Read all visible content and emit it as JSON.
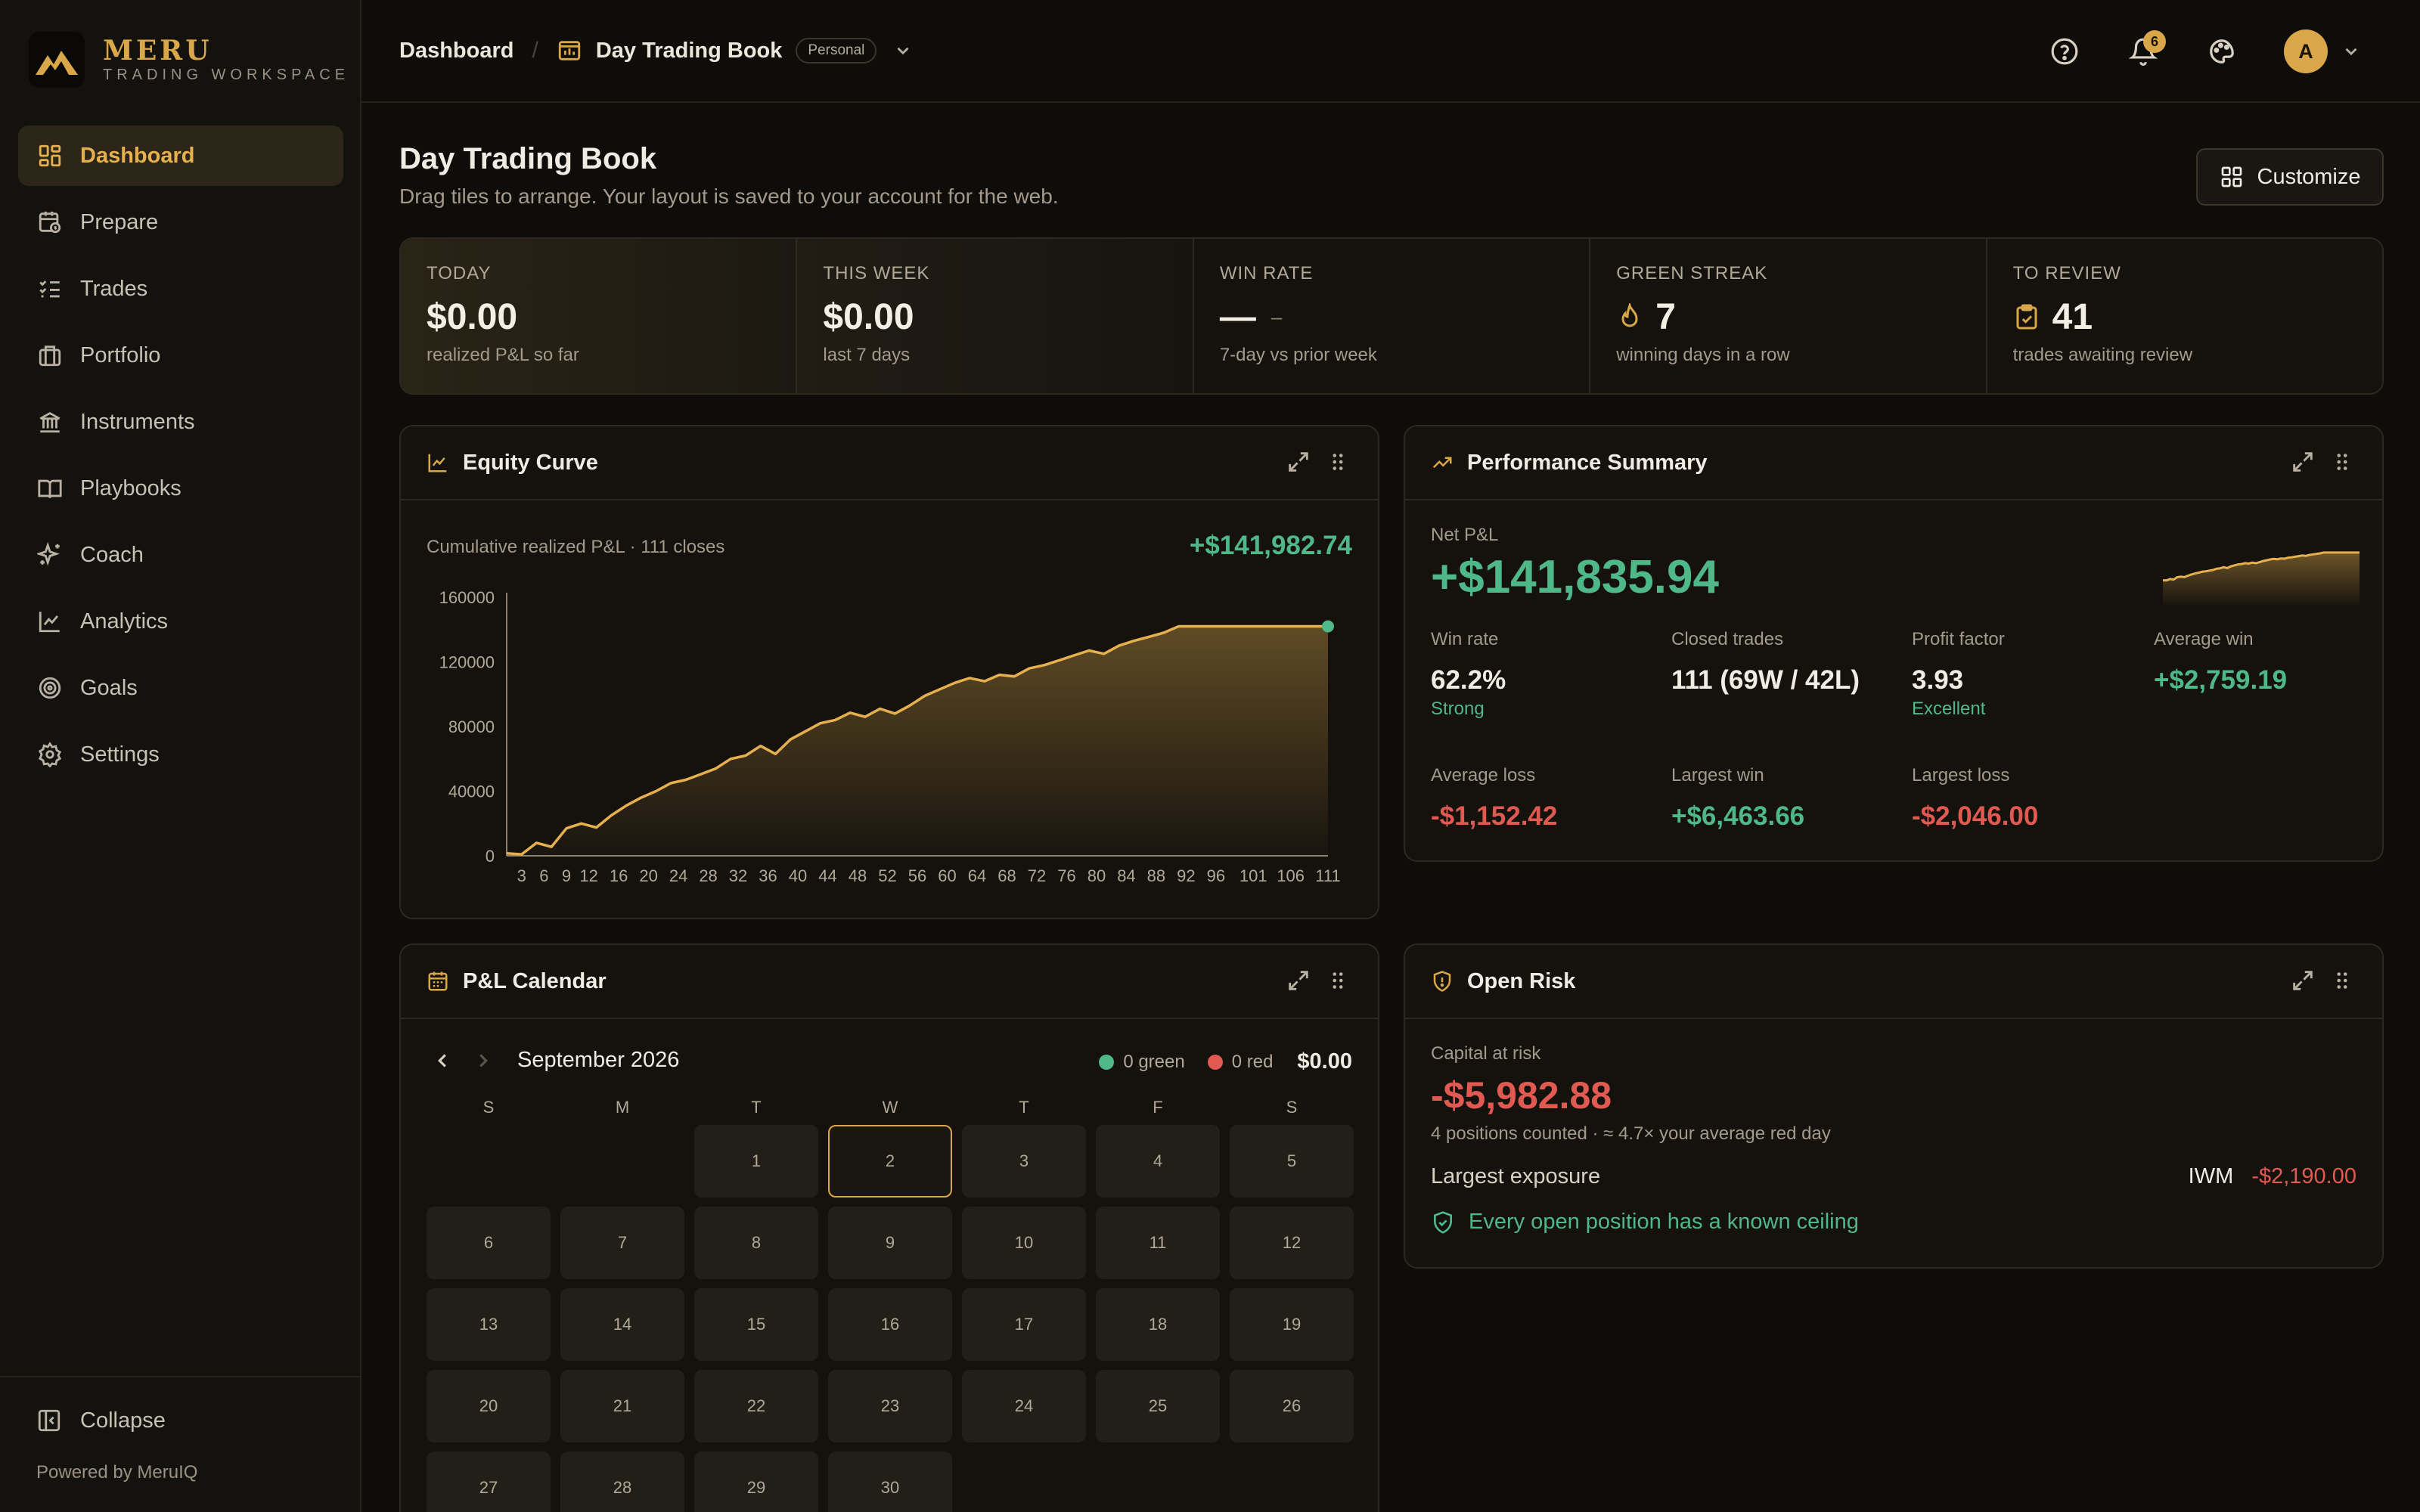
{
  "brand": {
    "name": "MERU",
    "subtitle": "TRADING WORKSPACE"
  },
  "sidebar": {
    "items": [
      {
        "label": "Dashboard",
        "icon": "dashboard-icon",
        "active": true
      },
      {
        "label": "Prepare",
        "icon": "calendar-clock-icon"
      },
      {
        "label": "Trades",
        "icon": "list-checks-icon"
      },
      {
        "label": "Portfolio",
        "icon": "briefcase-icon"
      },
      {
        "label": "Instruments",
        "icon": "bank-icon"
      },
      {
        "label": "Playbooks",
        "icon": "book-icon"
      },
      {
        "label": "Coach",
        "icon": "sparkles-icon"
      },
      {
        "label": "Analytics",
        "icon": "line-chart-icon"
      },
      {
        "label": "Goals",
        "icon": "target-icon"
      },
      {
        "label": "Settings",
        "icon": "gear-icon"
      }
    ],
    "collapse_label": "Collapse",
    "powered_by": "Powered by MeruIQ"
  },
  "topbar": {
    "breadcrumb_root": "Dashboard",
    "separator": "/",
    "book_name": "Day Trading Book",
    "book_badge": "Personal",
    "notification_count": "6",
    "avatar_initial": "A"
  },
  "page": {
    "title": "Day Trading Book",
    "subtitle": "Drag tiles to arrange. Your layout is saved to your account for the web.",
    "customize_label": "Customize"
  },
  "kpis": [
    {
      "label": "TODAY",
      "value": "$0.00",
      "sub": "realized P&L so far"
    },
    {
      "label": "THIS WEEK",
      "value": "$0.00",
      "sub": "last 7 days"
    },
    {
      "label": "WIN RATE",
      "value": "—",
      "small": "–",
      "sub": "7-day vs prior week"
    },
    {
      "label": "GREEN STREAK",
      "value": "7",
      "icon": "flame-icon",
      "sub": "winning days in a row"
    },
    {
      "label": "TO REVIEW",
      "value": "41",
      "icon": "clipboard-check-icon",
      "sub": "trades awaiting review"
    }
  ],
  "equity": {
    "title": "Equity Curve",
    "subtitle": "Cumulative realized P&L · 111 closes",
    "total": "+$141,982.74"
  },
  "chart_data": {
    "type": "area",
    "title": "Equity Curve",
    "xlabel": "",
    "ylabel": "",
    "xlim": [
      1,
      111
    ],
    "ylim": [
      0,
      160000
    ],
    "y_ticks": [
      "0",
      "40000",
      "80000",
      "120000",
      "160000"
    ],
    "x_ticks": [
      "3",
      "6",
      "9",
      "12",
      "16",
      "20",
      "24",
      "28",
      "32",
      "36",
      "40",
      "44",
      "48",
      "52",
      "56",
      "60",
      "64",
      "68",
      "72",
      "76",
      "80",
      "84",
      "88",
      "92",
      "96",
      "101",
      "106",
      "111"
    ],
    "series": [
      {
        "x": [
          1,
          3,
          5,
          7,
          9,
          11,
          13,
          15,
          17,
          19,
          21,
          23,
          25,
          27,
          29,
          31,
          33,
          35,
          37,
          39,
          41,
          43,
          45,
          47,
          49,
          51,
          53,
          55,
          57,
          59,
          61,
          63,
          65,
          67,
          69,
          71,
          73,
          75,
          77,
          79,
          81,
          83,
          85,
          87,
          89,
          91,
          93,
          95,
          97,
          99,
          101,
          103,
          105,
          107,
          109,
          111
        ],
        "y": [
          1500,
          900,
          8000,
          5500,
          17000,
          20000,
          17500,
          25000,
          31000,
          36000,
          40000,
          45000,
          47000,
          50500,
          54000,
          60000,
          62000,
          68000,
          63000,
          72000,
          77000,
          82000,
          84000,
          88500,
          86000,
          91000,
          88000,
          93000,
          99000,
          103000,
          107000,
          110000,
          108000,
          112000,
          111000,
          116000,
          118000,
          121000,
          124000,
          127000,
          125000,
          130000,
          133000,
          135500,
          138000,
          141982.74,
          141982.74,
          141982.74,
          141982.74,
          141982.74,
          141982.74,
          141982.74,
          141982.74,
          141982.74,
          141982.74,
          141982.74
        ]
      }
    ]
  },
  "performance": {
    "title": "Performance Summary",
    "net_label": "Net P&L",
    "net_value": "+$141,835.94",
    "win_rate": {
      "label": "Win rate",
      "value": "62.2%",
      "qual": "Strong"
    },
    "closed": {
      "label": "Closed trades",
      "value": "111 (69W / 42L)"
    },
    "profit_factor": {
      "label": "Profit factor",
      "value": "3.93",
      "qual": "Excellent"
    },
    "avg_win": {
      "label": "Average win",
      "value": "+$2,759.19"
    },
    "avg_loss": {
      "label": "Average loss",
      "value": "-$1,152.42"
    },
    "largest_win": {
      "label": "Largest win",
      "value": "+$6,463.66"
    },
    "largest_loss": {
      "label": "Largest loss",
      "value": "-$2,046.00"
    }
  },
  "calendar": {
    "title": "P&L Calendar",
    "month": "September 2026",
    "green_count": "0 green",
    "red_count": "0 red",
    "total": "$0.00",
    "weekdays": [
      "S",
      "M",
      "T",
      "W",
      "T",
      "F",
      "S"
    ],
    "first_weekday": 2,
    "days_in_month": 30,
    "today": 2
  },
  "risk": {
    "title": "Open Risk",
    "capital_label": "Capital at risk",
    "capital_value": "-$5,982.88",
    "sub": "4 positions counted · ≈ 4.7× your average red day",
    "exposure_label": "Largest exposure",
    "exposure_symbol": "IWM",
    "exposure_value": "-$2,190.00",
    "note": "Every open position has a known ceiling"
  },
  "colors": {
    "accent": "#d9a74a",
    "green": "#4fb889",
    "red": "#e05a52",
    "bg": "#0f0d0a"
  }
}
